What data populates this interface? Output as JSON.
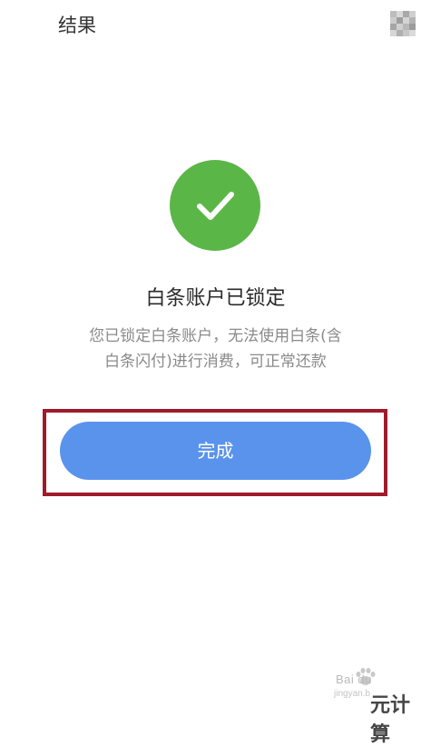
{
  "header": {
    "title": "结果",
    "menu_icon": "blurred-menu-icon"
  },
  "result": {
    "icon": "checkmark-icon",
    "icon_color": "#5bb648",
    "title": "白条账户已锁定",
    "description_line1": "您已锁定白条账户，无法使用白条(含",
    "description_line2": "白条闪付)进行消费，可正常还款"
  },
  "actions": {
    "done_label": "完成",
    "done_color": "#5a93ec"
  },
  "annotation": {
    "highlight_color": "#9e1b2a"
  },
  "watermark": {
    "brand": "Bai du",
    "sub": "jingyan.b",
    "site": "元计算"
  }
}
